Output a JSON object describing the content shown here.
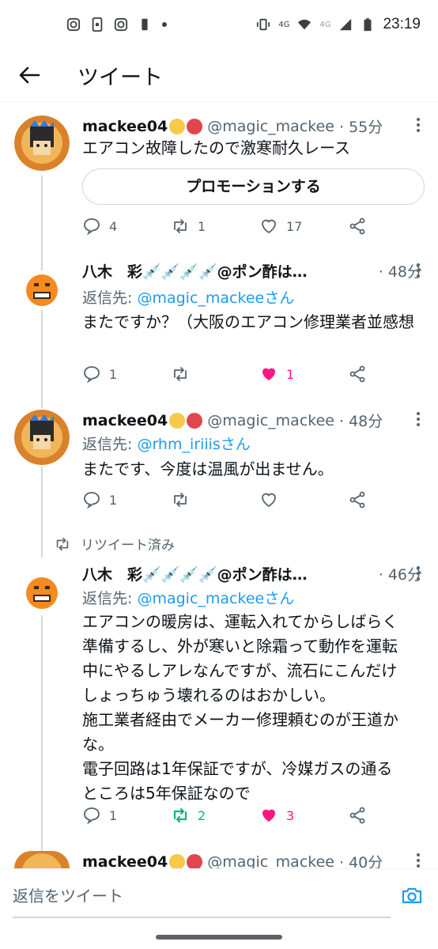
{
  "status_bar": {
    "time": "23:19",
    "network": "4G",
    "network2": "4G"
  },
  "header": {
    "title": "ツイート"
  },
  "tweets": [
    {
      "name": "mackee04",
      "handle": "@magic_mackee",
      "time": "· 55分",
      "body": "エアコン故障したので激寒耐久レース",
      "promo_label": "プロモーションする",
      "reply_count": "4",
      "retweet_count": "1",
      "like_count": "17"
    },
    {
      "name": "八木　彩💉💉💉💉@ポン酢は…",
      "time": "· 48分",
      "reply_prefix": "返信先: ",
      "reply_to": "@magic_mackeeさん",
      "body": "またですか？（大阪のエアコン修理業者並感想",
      "reply_count": "1",
      "like_count": "1"
    },
    {
      "name": "mackee04",
      "handle": "@magic_mackee",
      "time": "· 48分",
      "reply_prefix": "返信先: ",
      "reply_to": "@rhm_iriiisさん",
      "body": "またです、今度は温風が出ません。",
      "reply_count": "1"
    },
    {
      "retweeted_label": "リツイート済み",
      "name": "八木　彩💉💉💉💉@ポン酢は…",
      "time": "· 46分",
      "reply_prefix": "返信先: ",
      "reply_to": "@magic_mackeeさん",
      "body_lines": [
        "エアコンの暖房は、運転入れてからしばらく",
        "準備するし、外が寒いと除霜って動作を運転",
        "中にやるしアレなんですが、流石にこんだけ",
        "しょっちゅう壊れるのはおかしい。",
        "施工業者経由でメーカー修理頼むのが王道か",
        "な。",
        "電子回路は1年保証ですが、冷媒ガスの通る",
        "ところは5年保証なので"
      ],
      "reply_count": "1",
      "retweet_count": "2",
      "like_count": "3"
    },
    {
      "name": "mackee04",
      "handle": "@magic_mackee",
      "time": "· 40分"
    }
  ],
  "reply_bar": {
    "placeholder": "返信をツイート"
  },
  "colors": {
    "accent": "#1d9bf0",
    "like": "#f91880",
    "retweet": "#00ba7c",
    "muted": "#536471"
  }
}
